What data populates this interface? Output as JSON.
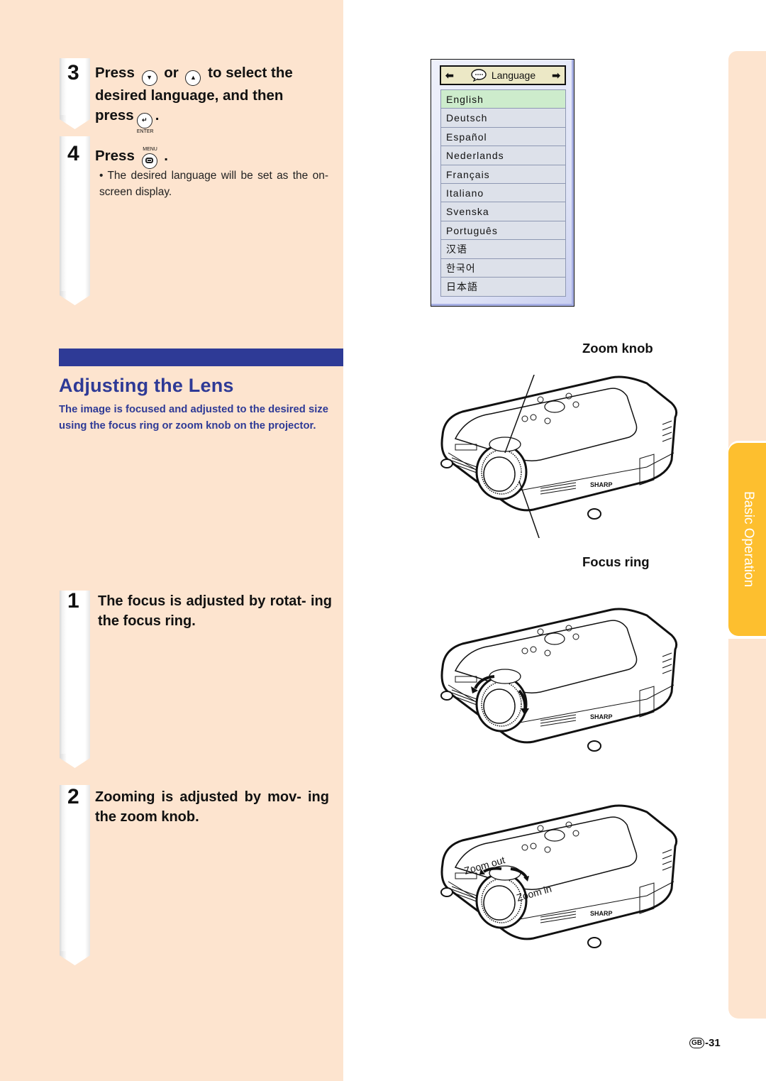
{
  "steps_top": [
    {
      "number": "3",
      "line1_press": "Press",
      "line1_or": "or",
      "line1_rest": "to select the",
      "line2": "desired language, and then",
      "line3_press": "press",
      "down_button_icon": "down-arrow-button-icon",
      "up_button_icon": "up-arrow-button-icon",
      "enter_button_label": "ENTER"
    },
    {
      "number": "4",
      "press": "Press",
      "menu_button_label": "MENU",
      "bullet": "The desired language will be set as the on-screen display."
    }
  ],
  "osd_menu": {
    "title": "Language",
    "left_arrow": "🡐",
    "right_arrow": "🡒",
    "items": [
      "English",
      "Deutsch",
      "Español",
      "Nederlands",
      "Français",
      "Italiano",
      "Svenska",
      "Português",
      "汉语",
      "한국어",
      "日本語"
    ],
    "selected": "English",
    "selected_color": "#cdeccc"
  },
  "section": {
    "title": "Adjusting the Lens",
    "intro": "The image is focused and adjusted to the desired size using the focus ring or zoom knob on the projector.",
    "accent_color": "#2e3a96"
  },
  "steps_bottom": [
    {
      "number": "1",
      "text": "The focus is adjusted by rotat- ing the focus ring."
    },
    {
      "number": "2",
      "text": "Zooming is adjusted  by mov- ing the zoom knob."
    }
  ],
  "figures": {
    "fig1": {
      "zoom_knob_label": "Zoom knob",
      "focus_ring_label": "Focus ring",
      "brand": "SHARP"
    },
    "fig2": {
      "brand": "SHARP"
    },
    "fig3": {
      "zoom_out_label": "Zoom out",
      "zoom_in_label": "Zoom in",
      "brand": "SHARP"
    }
  },
  "side_tab": {
    "label": "Basic Operation",
    "color": "#fdbf2f"
  },
  "footer": {
    "region_badge": "GB",
    "page_number": "-31"
  }
}
